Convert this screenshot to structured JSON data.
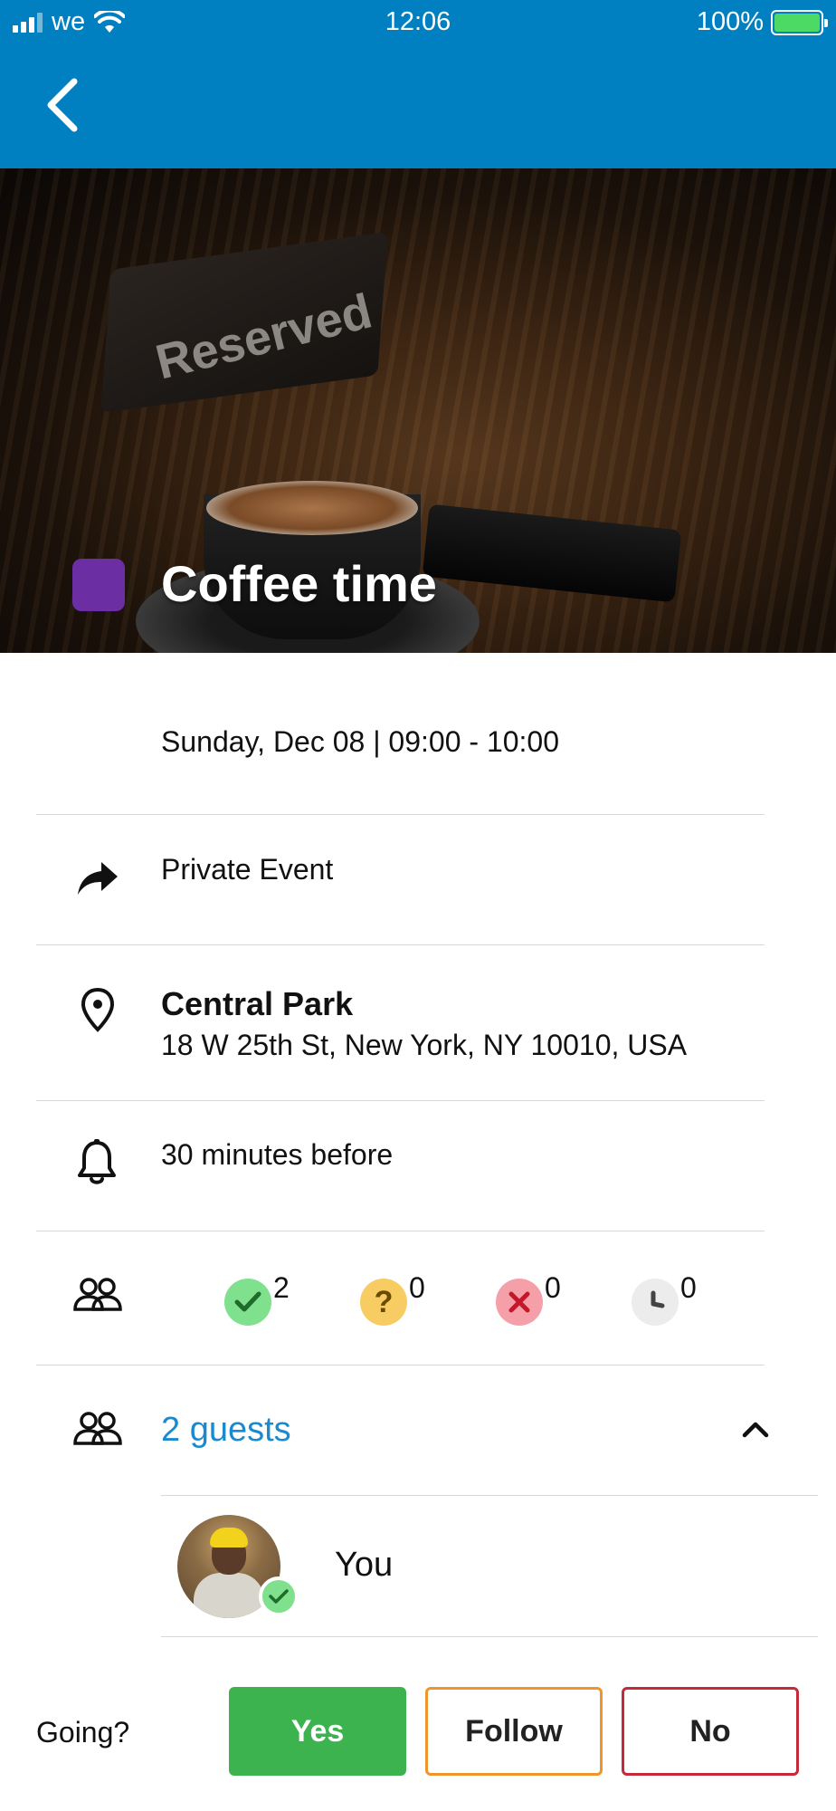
{
  "status_bar": {
    "carrier": "we",
    "time": "12:06",
    "battery": "100%"
  },
  "header": {
    "back_icon": "chevron-left-icon"
  },
  "event": {
    "title": "Coffee time",
    "tag_color": "#6b2fa3",
    "datetime": "Sunday, Dec 08 | 09:00 - 10:00",
    "privacy": "Private Event",
    "location_name": "Central Park",
    "location_address": "18 W 25th St, New York, NY 10010, USA",
    "reminder": "30 minutes before"
  },
  "rsvp_summary": {
    "going": "2",
    "maybe": "0",
    "declined": "0",
    "pending": "0"
  },
  "guests": {
    "link_label": "2 guests",
    "list": [
      {
        "name": "You",
        "status": "going"
      }
    ]
  },
  "footer": {
    "question": "Going?",
    "yes_label": "Yes",
    "follow_label": "Follow",
    "no_label": "No"
  },
  "colors": {
    "header_blue": "#0080c0",
    "link_blue": "#1a8ad0",
    "yes_green": "#3cb34f",
    "follow_orange": "#f0952a",
    "no_red": "#c42a3a"
  }
}
